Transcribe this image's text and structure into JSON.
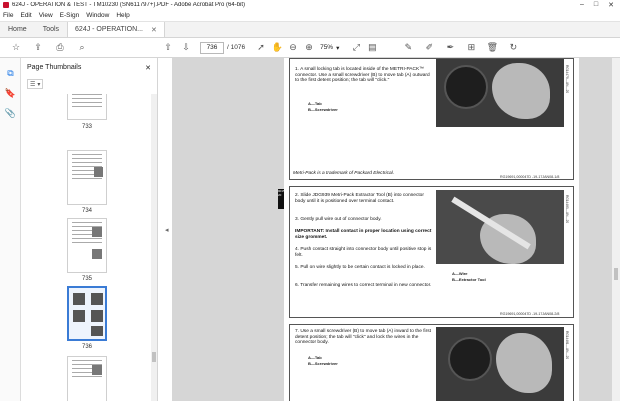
{
  "window": {
    "title": "624J - OPERATION & TEST - TM10230 (SN611797+).PDF - Adobe Acrobat Pro (64-bit)",
    "controls": [
      "–",
      "□",
      "✕"
    ]
  },
  "menu": [
    "File",
    "Edit",
    "View",
    "E-Sign",
    "Window",
    "Help"
  ],
  "tabs": {
    "home": "Home",
    "tools": "Tools",
    "doc": "624J - OPERATION..."
  },
  "toolbar": {
    "page_current": "736",
    "page_total": "/ 1076",
    "zoom": "75%"
  },
  "panel": {
    "title": "Page Thumbnails",
    "thumbs": [
      {
        "label": "733"
      },
      {
        "label": "734"
      },
      {
        "label": "735"
      },
      {
        "label": "736"
      },
      {
        "label": ""
      }
    ]
  },
  "doc": {
    "box1": {
      "step": "1. A small locking tab is located inside of the METRI-PACK™ connector. Use a small screwdriver (B) to move tab (A) outward to the first detent position; the tab will \"click.\"",
      "legend_a": "A—Tab",
      "legend_b": "B—Screwdriver",
      "note": "Metri-Pack is a trademark of Packard Electrical.",
      "code": "RG19691,000047D -19-17JAN08-1/8"
    },
    "box2": {
      "tag": "9015 20",
      "step2": "2. Slide JDG939 Metri-Pack Extractor Tool (B) into connector body until it is positioned over terminal contact.",
      "step3": "3. Gently pull wire out of connector body.",
      "important": "IMPORTANT: Install contact in proper location using correct size grommet.",
      "step4": "4. Push contact straight into connector body until positive stop is felt.",
      "step5": "5. Pull on wire slightly to be certain contact is locked in place.",
      "step6": "6. Transfer remaining wires to correct terminal in new connector.",
      "legend_a": "A—Wire",
      "legend_b": "B—Extractor Tool",
      "code": "RG19691,000047D -19-17JAN08-2/8"
    },
    "box3": {
      "step": "7. Use a small screwdriver (B) to move tab (A) inward to the first detent position; the tab will \"click\" and lock the wires in the connector body.",
      "legend_a": "A—Tab",
      "legend_b": "B—Screwdriver"
    }
  }
}
